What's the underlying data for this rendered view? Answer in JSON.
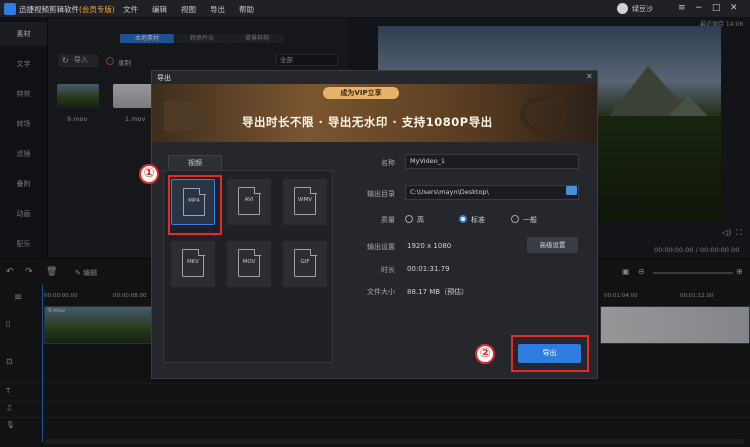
{
  "titlebar": {
    "app_title": "迅捷视频剪辑软件",
    "vip_tag": "(会员专版)",
    "menus": [
      "文件",
      "编辑",
      "视图",
      "导出",
      "帮助"
    ],
    "username": "绿豆沙",
    "clock": "14:06",
    "autosave": "最近保存 14:06"
  },
  "sidebar": {
    "items": [
      {
        "label": "素材"
      },
      {
        "label": "文字"
      },
      {
        "label": "特效"
      },
      {
        "label": "转场"
      },
      {
        "label": "滤镜"
      },
      {
        "label": "叠附"
      },
      {
        "label": "动画"
      },
      {
        "label": "配乐"
      }
    ]
  },
  "media": {
    "tabs": [
      "本地素材",
      "转场片头",
      "背景样例"
    ],
    "import_label": "导入",
    "record_label": "录制",
    "filter_value": "全部",
    "files": [
      {
        "name": "9.mov"
      },
      {
        "name": "1.mov"
      }
    ]
  },
  "preview": {
    "time_left": "00:00:00.00",
    "time_right": "00:00:00.00"
  },
  "timeline": {
    "edit_label": "编辑",
    "ruler": [
      "00:00:00.00",
      "00:00:08.00",
      "00:01:04.00",
      "00:01:12.00"
    ],
    "clip_label": "9.mov"
  },
  "dialog": {
    "title": "导出",
    "banner_pill": "成为VIP立享",
    "banner_text": "导出时长不限 · 导出无水印 · 支持1080P导出",
    "tab_video": "视频",
    "formats": [
      {
        "label": "MP4",
        "selected": true
      },
      {
        "label": "AVI"
      },
      {
        "label": "WMV"
      },
      {
        "label": "MKV"
      },
      {
        "label": "MOV"
      },
      {
        "label": "GIF"
      }
    ],
    "fields": {
      "name_label": "名称",
      "name_value": "MyVideo_1",
      "dir_label": "输出目录",
      "dir_value": "C:\\Users\\mayn\\Desktop\\",
      "quality_label": "质量",
      "quality_options": [
        "高",
        "标准",
        "一般"
      ],
      "quality_selected": "标准",
      "settings_label": "输出设置",
      "settings_value": "1920 x 1080",
      "duration_label": "时长",
      "duration_value": "00:01:31.79",
      "size_label": "文件大小",
      "size_value": "88.17 MB（预估）"
    },
    "advanced_label": "高级设置",
    "export_label": "导出"
  },
  "annotations": {
    "one": "①",
    "two": "②"
  },
  "colors": {
    "accent": "#2f7de1",
    "highlight": "#e32b2b",
    "vip": "#e5b46a"
  }
}
